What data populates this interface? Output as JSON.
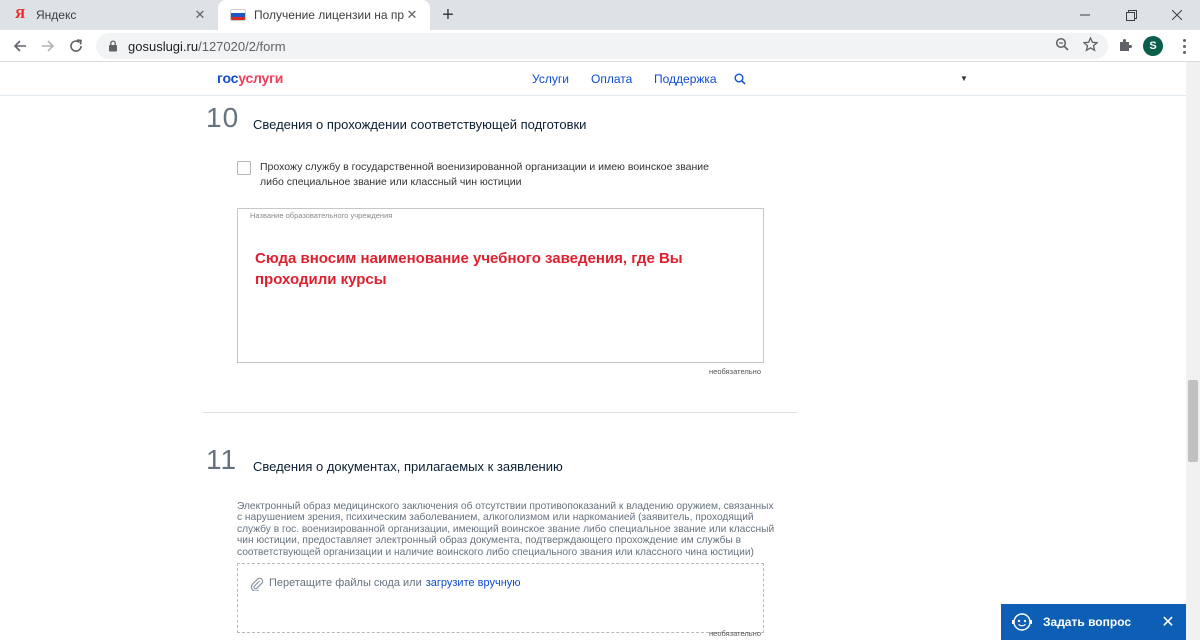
{
  "browser": {
    "tabs": [
      {
        "title": "Яндекс",
        "icon": "yandex-icon"
      },
      {
        "title": "Получение лицензии на приоб",
        "icon": "russia-flag-icon"
      }
    ],
    "new_tab": "+",
    "address": {
      "host": "gosuslugi.ru",
      "path": "/127020/2/form"
    },
    "profile_initial": "S"
  },
  "site": {
    "logo": {
      "part1": "гос",
      "part2": "услуги"
    },
    "nav": [
      "Услуги",
      "Оплата",
      "Поддержка"
    ],
    "colors": {
      "primary": "#0d4cd3",
      "accent": "#ee3f58",
      "annotation": "#e0202e"
    }
  },
  "section10": {
    "number": "10",
    "title": "Сведения о прохождении соответствующей подготовки",
    "checkbox_label": "Прохожу службу в государственной военизированной организации и имею воинское звание либо специальное звание или классный чин юстиции",
    "checkbox_checked": false,
    "textarea_placeholder": "Название образовательного учреждения",
    "textarea_value": "Сюда вносим наименование учебного заведения, где Вы проходили курсы",
    "optional": "необязательно"
  },
  "section11": {
    "number": "11",
    "title": "Сведения о документах, прилагаемых к заявлению",
    "description": "Электронный образ медицинского заключения об отсутствии противопоказаний к владению оружием, связанных с нарушением зрения, психическим заболеванием, алкоголизмом или наркоманией (заявитель, проходящий службу в гос. военизированной организации, имеющий воинское звание либо специальное звание или классный чин юстиции, предоставляет электронный образ документа, подтверждающего прохождение им службы в соответствующей организации и наличие воинского либо специального звания или классного чина юстиции)",
    "dropzone_text": "Перетащите файлы сюда или",
    "dropzone_link": "загрузите вручную",
    "optional": "необязательно"
  },
  "chat": {
    "label": "Задать вопрос"
  }
}
